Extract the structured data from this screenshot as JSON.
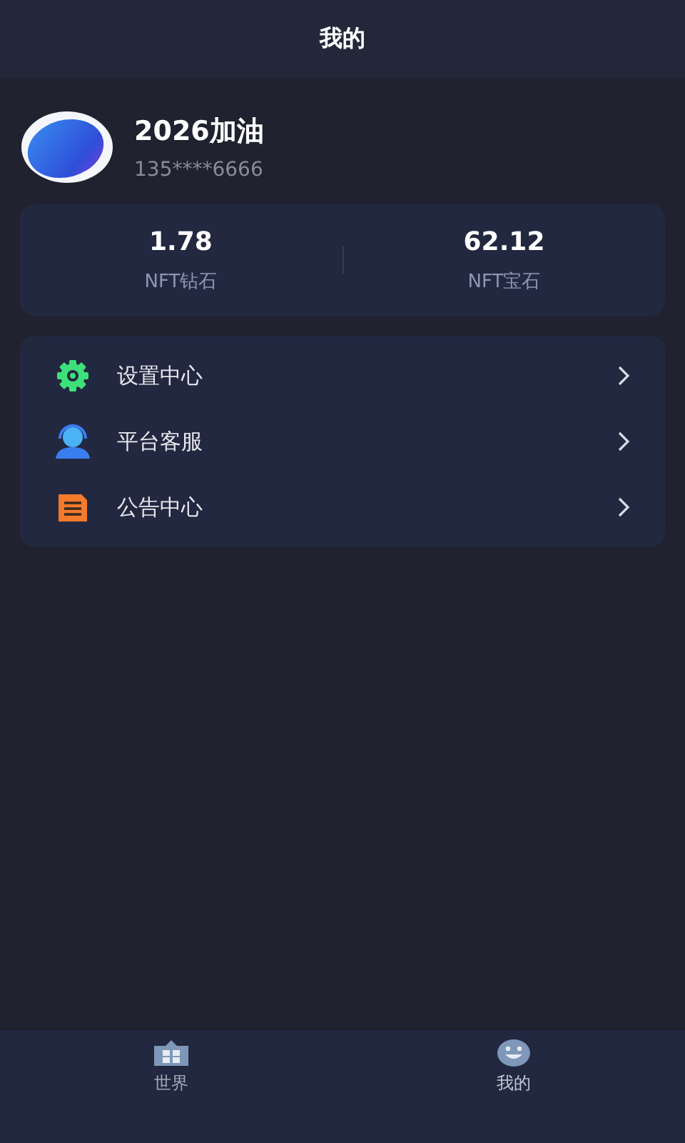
{
  "header": {
    "title": "我的"
  },
  "profile": {
    "name": "2026加油",
    "phone": "135****6666"
  },
  "stats": [
    {
      "value": "1.78",
      "label": "NFT钻石"
    },
    {
      "value": "62.12",
      "label": "NFT宝石"
    }
  ],
  "menu": [
    {
      "kind": "settings",
      "label": "设置中心"
    },
    {
      "kind": "support",
      "label": "平台客服"
    },
    {
      "kind": "notice",
      "label": "公告中心"
    }
  ],
  "tabs": [
    {
      "kind": "world",
      "label": "世界",
      "selected": false
    },
    {
      "kind": "me",
      "label": "我的",
      "selected": true
    }
  ]
}
